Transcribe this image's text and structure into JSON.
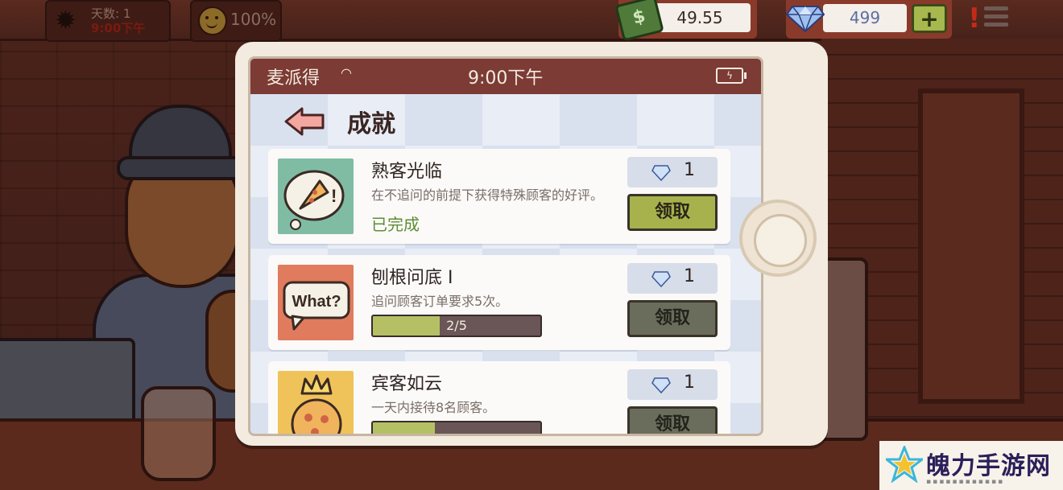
{
  "hud": {
    "day_label": "天数: 1",
    "day_time": "9:00下午",
    "mood_percent": "100%",
    "money": "49.55",
    "money_symbol": "$",
    "gems": "499",
    "plus_label": "+",
    "alert_label": "!"
  },
  "phone": {
    "app_name": "麦派得",
    "time": "9:00下午",
    "page_title": "成就"
  },
  "achievements": [
    {
      "name": "熟客光临",
      "description": "在不追问的前提下获得特殊顾客的好评。",
      "status": "已完成",
      "reward": "1",
      "claim_label": "领取",
      "claim_active": true,
      "thumb": "pizza-thought-icon"
    },
    {
      "name": "刨根问底 Ⅰ",
      "description": "追问顾客订单要求5次。",
      "progress_text": "2/5",
      "progress_fraction": 0.4,
      "reward": "1",
      "claim_label": "领取",
      "claim_active": false,
      "thumb": "what-speech-bubble-icon",
      "thumb_text": "What?"
    },
    {
      "name": "宾客如云",
      "description": "一天内接待8名顾客。",
      "progress_fraction": 0.37,
      "reward": "1",
      "claim_label": "领取",
      "claim_active": false,
      "thumb": "crowned-pizza-icon"
    }
  ],
  "watermark": {
    "text": "魄力手游网"
  },
  "colors": {
    "status_bar": "#7c3b35",
    "claim_active": "#a7b24c",
    "claim_inactive": "#6b6d5c",
    "progress_fill": "#b5c065",
    "completed_text": "#5e8c34"
  }
}
